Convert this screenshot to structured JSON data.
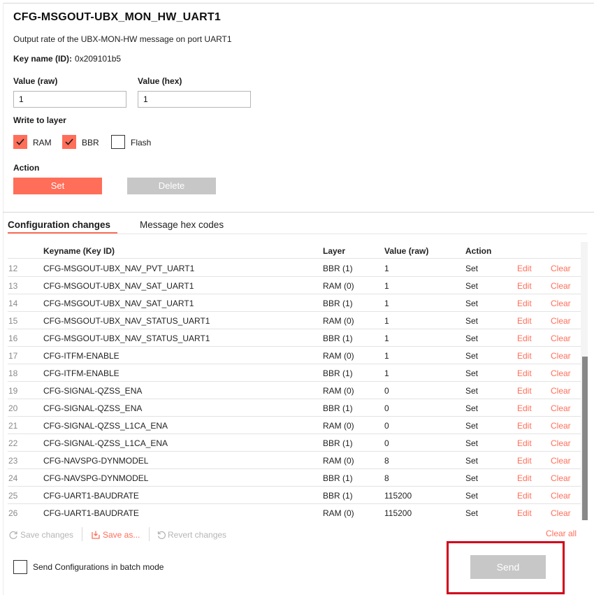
{
  "header": {
    "title": "CFG-MSGOUT-UBX_MON_HW_UART1",
    "description": "Output rate of the UBX-MON-HW message on port UART1",
    "key_name_label": "Key name (ID):",
    "key_name_value": "0x209101b5"
  },
  "fields": {
    "value_raw_label": "Value (raw)",
    "value_raw": "1",
    "value_hex_label": "Value (hex)",
    "value_hex": "1"
  },
  "layers": {
    "label": "Write to layer",
    "items": [
      {
        "label": "RAM",
        "checked": true
      },
      {
        "label": "BBR",
        "checked": true
      },
      {
        "label": "Flash",
        "checked": false
      }
    ]
  },
  "action": {
    "label": "Action",
    "set_label": "Set",
    "delete_label": "Delete"
  },
  "tabs": [
    {
      "label": "Configuration changes",
      "active": true
    },
    {
      "label": "Message hex codes",
      "active": false
    }
  ],
  "table": {
    "columns": [
      "Keyname (Key ID)",
      "Layer",
      "Value (raw)",
      "Action"
    ],
    "edit_label": "Edit",
    "clear_label": "Clear",
    "rows": [
      {
        "idx": "12",
        "key": "CFG-MSGOUT-UBX_NAV_PVT_UART1",
        "layer": "BBR (1)",
        "value": "1",
        "action": "Set"
      },
      {
        "idx": "13",
        "key": "CFG-MSGOUT-UBX_NAV_SAT_UART1",
        "layer": "RAM (0)",
        "value": "1",
        "action": "Set"
      },
      {
        "idx": "14",
        "key": "CFG-MSGOUT-UBX_NAV_SAT_UART1",
        "layer": "BBR (1)",
        "value": "1",
        "action": "Set"
      },
      {
        "idx": "15",
        "key": "CFG-MSGOUT-UBX_NAV_STATUS_UART1",
        "layer": "RAM (0)",
        "value": "1",
        "action": "Set"
      },
      {
        "idx": "16",
        "key": "CFG-MSGOUT-UBX_NAV_STATUS_UART1",
        "layer": "BBR (1)",
        "value": "1",
        "action": "Set"
      },
      {
        "idx": "17",
        "key": "CFG-ITFM-ENABLE",
        "layer": "RAM (0)",
        "value": "1",
        "action": "Set"
      },
      {
        "idx": "18",
        "key": "CFG-ITFM-ENABLE",
        "layer": "BBR (1)",
        "value": "1",
        "action": "Set"
      },
      {
        "idx": "19",
        "key": "CFG-SIGNAL-QZSS_ENA",
        "layer": "RAM (0)",
        "value": "0",
        "action": "Set"
      },
      {
        "idx": "20",
        "key": "CFG-SIGNAL-QZSS_ENA",
        "layer": "BBR (1)",
        "value": "0",
        "action": "Set"
      },
      {
        "idx": "21",
        "key": "CFG-SIGNAL-QZSS_L1CA_ENA",
        "layer": "RAM (0)",
        "value": "0",
        "action": "Set"
      },
      {
        "idx": "22",
        "key": "CFG-SIGNAL-QZSS_L1CA_ENA",
        "layer": "BBR (1)",
        "value": "0",
        "action": "Set"
      },
      {
        "idx": "23",
        "key": "CFG-NAVSPG-DYNMODEL",
        "layer": "RAM (0)",
        "value": "8",
        "action": "Set"
      },
      {
        "idx": "24",
        "key": "CFG-NAVSPG-DYNMODEL",
        "layer": "BBR (1)",
        "value": "8",
        "action": "Set"
      },
      {
        "idx": "25",
        "key": "CFG-UART1-BAUDRATE",
        "layer": "BBR (1)",
        "value": "115200",
        "action": "Set"
      },
      {
        "idx": "26",
        "key": "CFG-UART1-BAUDRATE",
        "layer": "RAM (0)",
        "value": "115200",
        "action": "Set"
      }
    ]
  },
  "toolbar": {
    "save_changes": "Save changes",
    "save_as": "Save as...",
    "revert_changes": "Revert changes",
    "clear_all": "Clear all"
  },
  "footer": {
    "batch_label": "Send Configurations in batch mode",
    "batch_checked": false,
    "send_label": "Send"
  },
  "colors": {
    "accent": "#ff6e59",
    "disabled": "#c7c7c7",
    "highlight": "#d0021b"
  }
}
